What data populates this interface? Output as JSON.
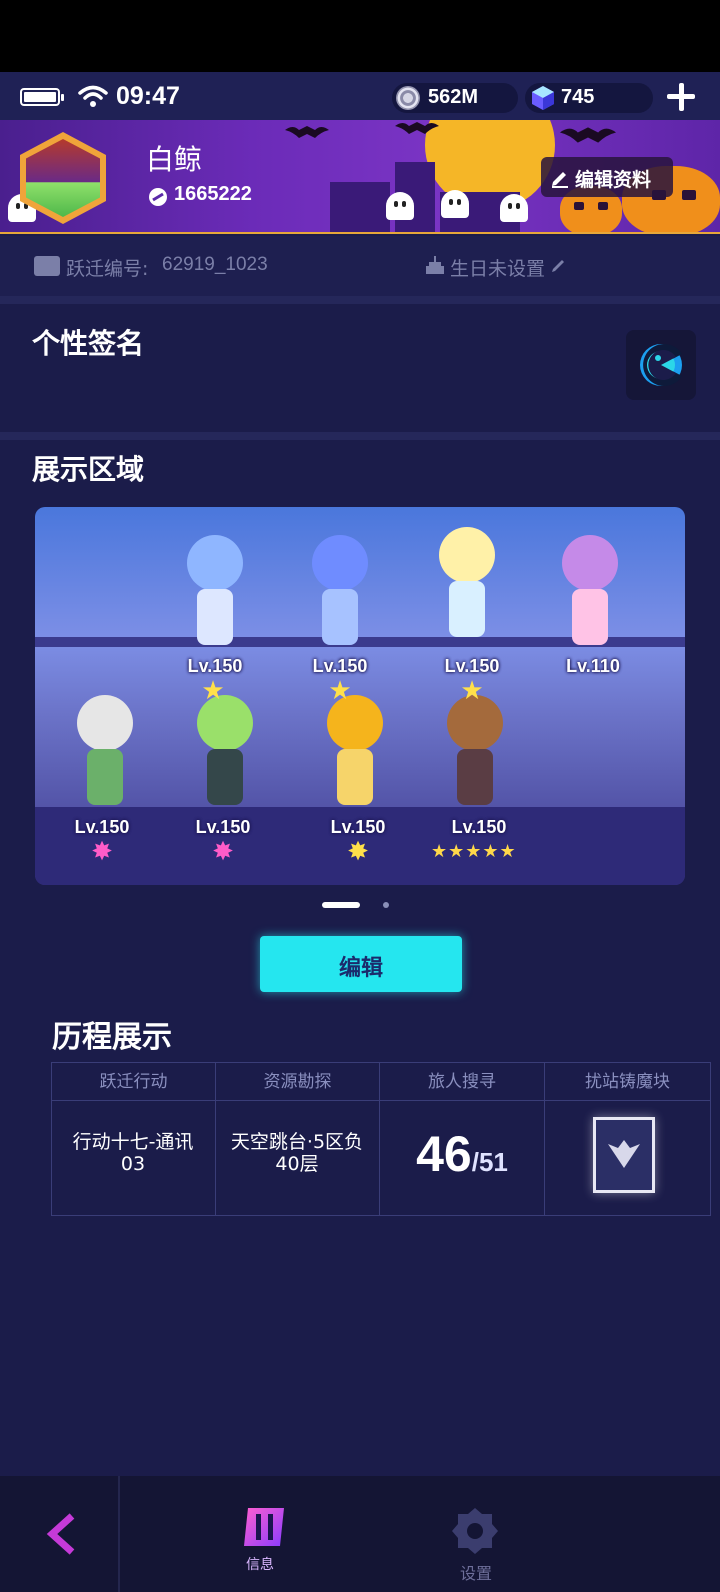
{
  "status_bar": {
    "time": "09:47",
    "battery_level": 1.0
  },
  "currencies": {
    "coins": {
      "icon": "coin-icon",
      "value": "562M"
    },
    "gems": {
      "icon": "gem-icon",
      "value": "745"
    }
  },
  "profile": {
    "name": "白鲸",
    "uid": "1665222",
    "edit_label": "编辑资料",
    "jump_label": "跃迁编号:",
    "jump_value": "62919_1023",
    "birthday_label": "生日未设置"
  },
  "signature": {
    "title": "个性签名"
  },
  "showcase": {
    "title": "展示区域",
    "top_row": [
      {
        "level": "Lv.150",
        "mark": "★"
      },
      {
        "level": "Lv.150",
        "mark": "★"
      },
      {
        "level": "Lv.150",
        "mark": "★"
      },
      {
        "level": "Lv.110",
        "mark": ""
      }
    ],
    "bottom_row": [
      {
        "level": "Lv.150",
        "mark": "✸"
      },
      {
        "level": "Lv.150",
        "mark": "✸"
      },
      {
        "level": "Lv.150",
        "mark": "✸"
      },
      {
        "level": "Lv.150",
        "mark": "★★★★★"
      }
    ],
    "pages": 2,
    "current_page": 1
  },
  "edit_button": {
    "label": "编辑"
  },
  "journey": {
    "title": "历程展示",
    "columns": [
      {
        "header": "跃迁行动",
        "value": "行动十七-通讯03"
      },
      {
        "header": "资源勘探",
        "value": "天空跳台·5区负40层"
      },
      {
        "header": "旅人搜寻",
        "count": "46",
        "total": "/51"
      },
      {
        "header": "扰站铸魔块",
        "icon": "chip-icon"
      }
    ]
  },
  "bottom_nav": {
    "back_icon": "back-arrow-icon",
    "info_label": "信息",
    "settings_label": "设置"
  },
  "colors": {
    "background": "#1b1c4a",
    "accent_cyan": "#25e6ef",
    "banner_purple": "#6b2bb8",
    "muted_text": "#7b7fa8",
    "back_arrow": "#c53ad8"
  }
}
